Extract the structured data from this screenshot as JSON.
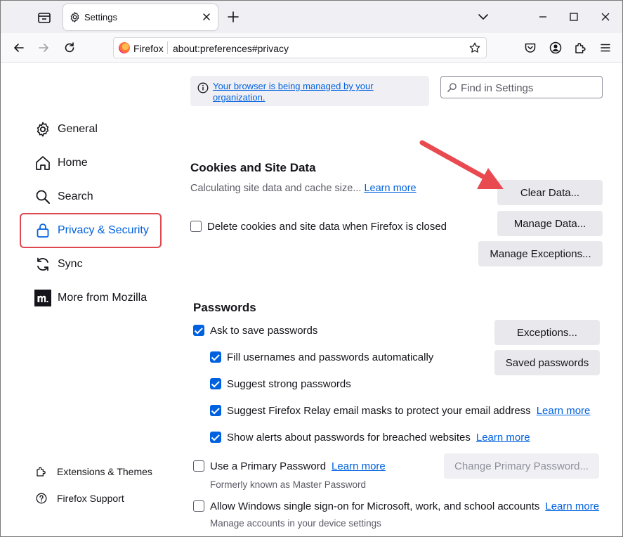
{
  "tab": {
    "title": "Settings",
    "icon": "gear-icon"
  },
  "urlbar": {
    "identity": "Firefox",
    "url": "about:preferences#privacy"
  },
  "managed": {
    "text": "Your browser is being managed by your organization."
  },
  "search": {
    "placeholder": "Find in Settings"
  },
  "sidebar": {
    "items": [
      {
        "label": "General",
        "icon": "gear-icon"
      },
      {
        "label": "Home",
        "icon": "home-icon"
      },
      {
        "label": "Search",
        "icon": "search-icon"
      },
      {
        "label": "Privacy & Security",
        "icon": "lock-icon",
        "active": true
      },
      {
        "label": "Sync",
        "icon": "sync-icon"
      },
      {
        "label": "More from Mozilla",
        "icon": "mozilla-icon"
      }
    ],
    "footer": [
      {
        "label": "Extensions & Themes",
        "icon": "puzzle-icon"
      },
      {
        "label": "Firefox Support",
        "icon": "help-icon"
      }
    ]
  },
  "cookies": {
    "title": "Cookies and Site Data",
    "status": "Calculating site data and cache size...",
    "learn_more": "Learn more",
    "clear_btn": "Clear Data...",
    "manage_btn": "Manage Data...",
    "exceptions_btn": "Manage Exceptions...",
    "delete_label": "Delete cookies and site data when Firefox is closed",
    "delete_checked": false
  },
  "passwords": {
    "title": "Passwords",
    "ask_label": "Ask to save passwords",
    "fill_label": "Fill usernames and passwords automatically",
    "suggest_label": "Suggest strong passwords",
    "relay_label": "Suggest Firefox Relay email masks to protect your email address",
    "relay_link": "Learn more",
    "alerts_label": "Show alerts about passwords for breached websites",
    "alerts_link": "Learn more",
    "exceptions_btn": "Exceptions...",
    "saved_btn": "Saved passwords",
    "primary_label": "Use a Primary Password",
    "primary_link": "Learn more",
    "primary_note": "Formerly known as Master Password",
    "change_btn": "Change Primary Password...",
    "sso_label": "Allow Windows single sign-on for Microsoft, work, and school accounts",
    "sso_link": "Learn more",
    "sso_note": "Manage accounts in your device settings"
  },
  "colors": {
    "accent": "#0061e0",
    "highlight": "#e0484f",
    "arrow": "#e84a50"
  }
}
